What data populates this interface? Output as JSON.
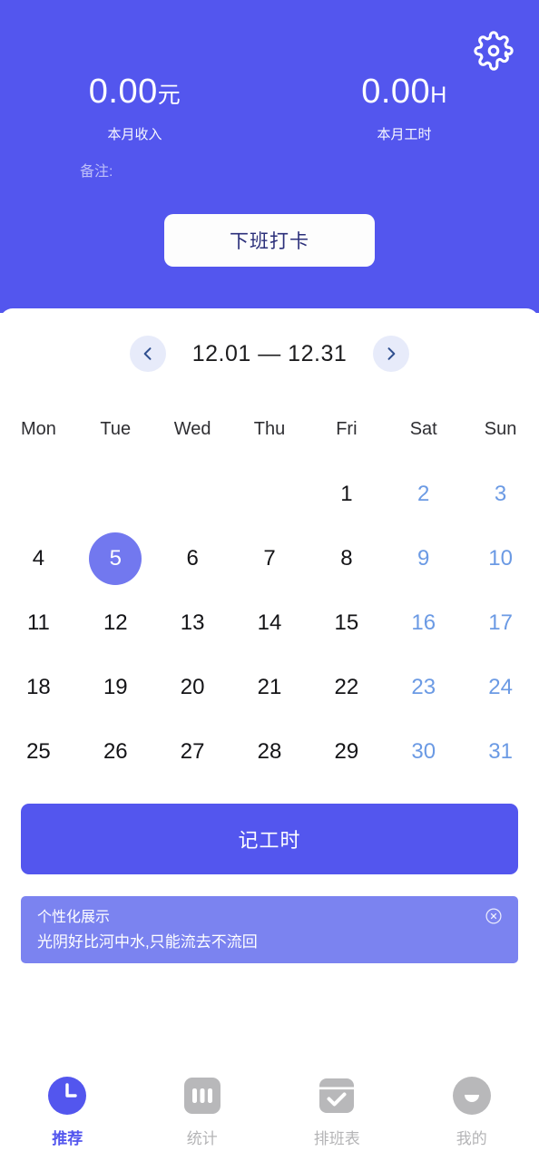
{
  "header": {
    "gear_icon": "gear-icon",
    "remark_label": "备注:",
    "punch_button": "下班打卡",
    "stats": [
      {
        "value": "0.00",
        "unit": "元",
        "label": "本月收入"
      },
      {
        "value": "0.00",
        "unit": "H",
        "label": "本月工时"
      }
    ]
  },
  "calendar": {
    "prev_icon": "chevron-left-icon",
    "next_icon": "chevron-right-icon",
    "range": "12.01 — 12.31",
    "weekdays": [
      "Mon",
      "Tue",
      "Wed",
      "Thu",
      "Fri",
      "Sat",
      "Sun"
    ],
    "selected_day": "5",
    "weeks": [
      [
        "",
        "",
        "",
        "",
        "1",
        "2",
        "3"
      ],
      [
        "4",
        "5",
        "6",
        "7",
        "8",
        "9",
        "10"
      ],
      [
        "11",
        "12",
        "13",
        "14",
        "15",
        "16",
        "17"
      ],
      [
        "18",
        "19",
        "20",
        "21",
        "22",
        "23",
        "24"
      ],
      [
        "25",
        "26",
        "27",
        "28",
        "29",
        "30",
        "31"
      ]
    ]
  },
  "record_button": "记工时",
  "banner": {
    "title": "个性化展示",
    "text": "光阴好比河中水,只能流去不流回",
    "close_icon": "close-circle-icon"
  },
  "bottom_nav": [
    {
      "label": "推荐",
      "icon": "clock-icon",
      "active": true
    },
    {
      "label": "统计",
      "icon": "bar-chart-icon",
      "active": false
    },
    {
      "label": "排班表",
      "icon": "calendar-check-icon",
      "active": false
    },
    {
      "label": "我的",
      "icon": "smiley-face-icon",
      "active": false
    }
  ],
  "colors": {
    "brand": "#5356ee",
    "banner": "#7b83f0",
    "selected_day": "#7278ef",
    "weekend_text": "#6b9ae4",
    "inactive_nav": "#b4b4b6"
  }
}
